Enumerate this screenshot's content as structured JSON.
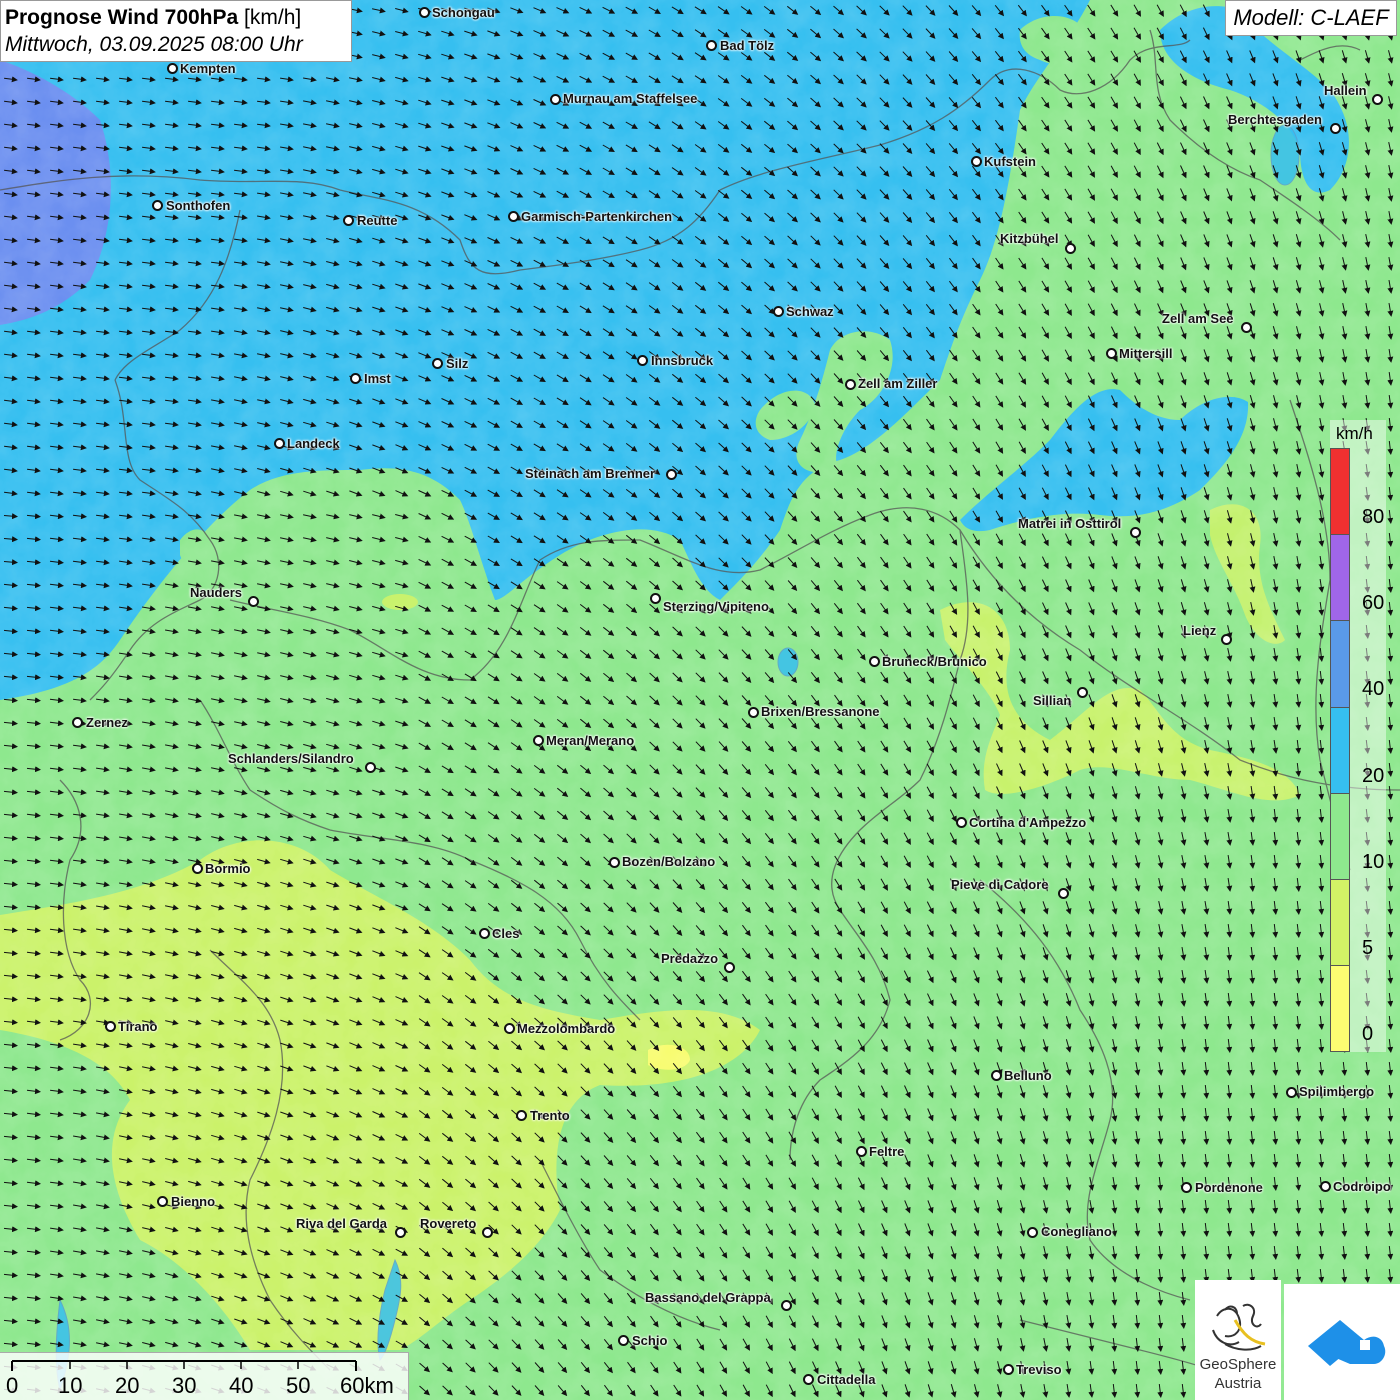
{
  "header": {
    "title_bold": "Prognose Wind 700hPa",
    "title_unit": "[km/h]",
    "datetime": "Mittwoch, 03.09.2025 08:00 Uhr",
    "model": "Modell: C-LAEF"
  },
  "legend": {
    "unit": "km/h",
    "ticks": [
      "80",
      "60",
      "40",
      "20",
      "10",
      "5",
      "0"
    ],
    "colors": [
      "#f03030",
      "#a066e8",
      "#5a9ae8",
      "#36bff0",
      "#8ee88e",
      "#d2f366",
      "#fdfd72"
    ]
  },
  "scalebar": {
    "labels": [
      "0",
      "10",
      "20",
      "30",
      "40",
      "50",
      "60km"
    ]
  },
  "logos": {
    "geosphere_line1": "GeoSphere",
    "geosphere_line2": "Austria",
    "geosphere_icon": "geosphere-swirl-icon",
    "app_icon": "cloud-arrow-icon"
  },
  "cities": [
    {
      "name": "Schongau"
    },
    {
      "name": "Bad Tölz"
    },
    {
      "name": "Kempten"
    },
    {
      "name": "Murnau am Staffelsee"
    },
    {
      "name": "Hallein"
    },
    {
      "name": "Berchtesgaden"
    },
    {
      "name": "Kufstein"
    },
    {
      "name": "Sonthofen"
    },
    {
      "name": "Reutte"
    },
    {
      "name": "Garmisch-Partenkirchen"
    },
    {
      "name": "Kitzbühel"
    },
    {
      "name": "Schwaz"
    },
    {
      "name": "Zell am See"
    },
    {
      "name": "Mittersill"
    },
    {
      "name": "Innsbruck"
    },
    {
      "name": "Silz"
    },
    {
      "name": "Imst"
    },
    {
      "name": "Zell am Ziller"
    },
    {
      "name": "Landeck"
    },
    {
      "name": "Steinach am Brenner"
    },
    {
      "name": "Matrei in Osttirol"
    },
    {
      "name": "Nauders"
    },
    {
      "name": "Sterzing/Vipiteno"
    },
    {
      "name": "Lienz"
    },
    {
      "name": "Bruneck/Brunico"
    },
    {
      "name": "Sillian"
    },
    {
      "name": "Brixen/Bressanone"
    },
    {
      "name": "Zernez"
    },
    {
      "name": "Meran/Merano"
    },
    {
      "name": "Schlanders/Silandro"
    },
    {
      "name": "Cortina d'Ampezzo"
    },
    {
      "name": "Bozen/Bolzano"
    },
    {
      "name": "Bormio"
    },
    {
      "name": "Pieve di Cadore"
    },
    {
      "name": "Cles"
    },
    {
      "name": "Predazzo"
    },
    {
      "name": "Tirano"
    },
    {
      "name": "Mezzolombardo"
    },
    {
      "name": "Belluno"
    },
    {
      "name": "Spilimbergo"
    },
    {
      "name": "Trento"
    },
    {
      "name": "Feltre"
    },
    {
      "name": "Pordenone"
    },
    {
      "name": "Codroipo"
    },
    {
      "name": "Bienno"
    },
    {
      "name": "Riva del Garda"
    },
    {
      "name": "Rovereto"
    },
    {
      "name": "Conegliano"
    },
    {
      "name": "Bassano del Grappa"
    },
    {
      "name": "Schio"
    },
    {
      "name": "Treviso"
    },
    {
      "name": "Cittadella"
    }
  ]
}
